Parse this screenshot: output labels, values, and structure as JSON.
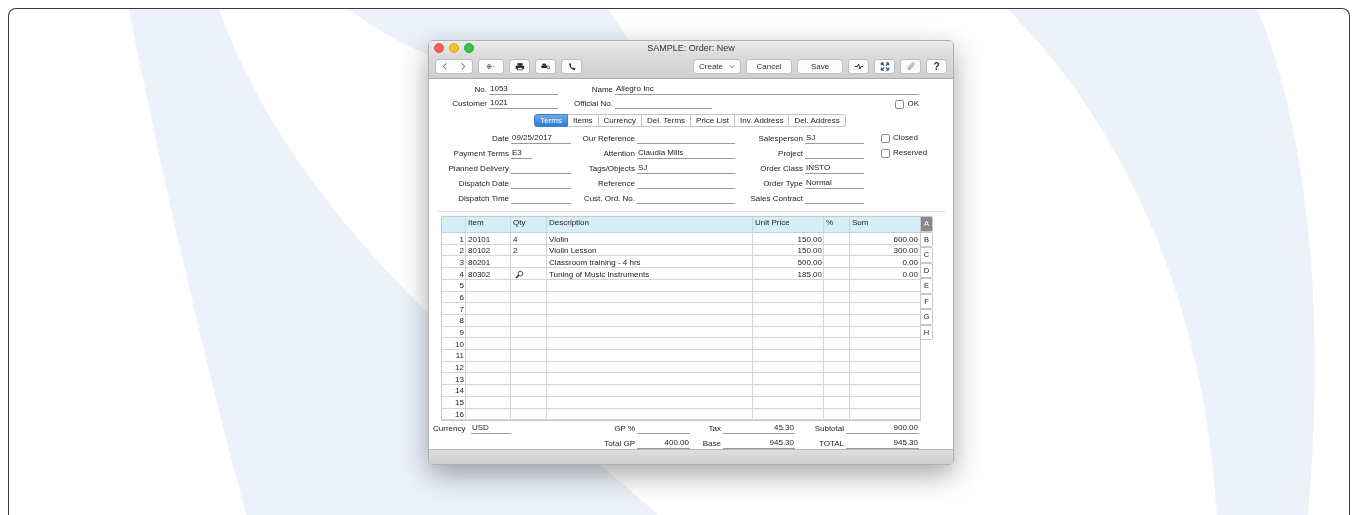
{
  "window": {
    "title": "SAMPLE: Order: New"
  },
  "toolbar": {
    "buttons": [
      {
        "label": "Create",
        "kind": "dropdown"
      },
      {
        "label": "Cancel",
        "kind": "plain"
      },
      {
        "label": "Save",
        "kind": "plain"
      }
    ],
    "help": "?"
  },
  "header": {
    "no": {
      "label": "No.",
      "value": "1053"
    },
    "name": {
      "label": "Name",
      "value": "Allegro Inc"
    },
    "customer": {
      "label": "Customer",
      "value": "1021"
    },
    "official_no": {
      "label": "Official No."
    },
    "ok": {
      "label": "OK",
      "checked": false
    }
  },
  "tabs": [
    {
      "label": "Terms",
      "selected": true
    },
    {
      "label": "Items",
      "selected": false
    },
    {
      "label": "Currency",
      "selected": false
    },
    {
      "label": "Del. Terms",
      "selected": false
    },
    {
      "label": "Price List",
      "selected": false
    },
    {
      "label": "Inv. Address",
      "selected": false
    },
    {
      "label": "Del. Address",
      "selected": false
    }
  ],
  "terms": {
    "column_1": [
      {
        "label": "Date",
        "value": "09/25/2017"
      },
      {
        "label": "Payment Terms",
        "value": "E3",
        "short": true
      },
      {
        "label": "Planned Delivery"
      },
      {
        "label": "Dispatch Date"
      },
      {
        "label": "Dispatch Time"
      }
    ],
    "column_2": [
      {
        "label": "Our Reference"
      },
      {
        "label": "Attention",
        "value": "Claudia Mills"
      },
      {
        "label": "Tags/Objects",
        "value": "SJ"
      },
      {
        "label": "Reference"
      },
      {
        "label": "Cust. Ord. No."
      }
    ],
    "column_3": [
      {
        "label": "Salesperson",
        "value": "SJ"
      },
      {
        "label": "Project"
      },
      {
        "label": "Order Class",
        "value": "INSTO"
      },
      {
        "label": "Order Type",
        "value": "Normal"
      },
      {
        "label": "Sales Contract"
      }
    ],
    "checkboxes": [
      {
        "label": "Closed",
        "checked": false
      },
      {
        "label": "Reserved",
        "checked": false
      }
    ]
  },
  "table": {
    "columns": [
      "Item",
      "Qty",
      "Description",
      "Unit Price",
      "%",
      "Sum"
    ],
    "rows": [
      {
        "no": "1",
        "item": "20101",
        "qty": "4",
        "description": "Violin",
        "unit_price": "150.00",
        "sum": "600.00",
        "lookup": false
      },
      {
        "no": "2",
        "item": "80102",
        "qty": "2",
        "description": "Violin Lesson",
        "unit_price": "150.00",
        "sum": "300.00",
        "lookup": false
      },
      {
        "no": "3",
        "item": "80201",
        "description": "Classroom training - 4 hrs",
        "unit_price": "500.00",
        "sum": "0.00",
        "lookup": false
      },
      {
        "no": "4",
        "item": "80302",
        "description": "Tuning of Music Instruments",
        "unit_price": "185.00",
        "sum": "0.00",
        "lookup": true
      },
      {
        "no": "5",
        "lookup": false
      },
      {
        "no": "6",
        "lookup": false
      },
      {
        "no": "7",
        "lookup": false
      },
      {
        "no": "8",
        "lookup": false
      },
      {
        "no": "9",
        "lookup": false
      },
      {
        "no": "10",
        "lookup": false
      },
      {
        "no": "11",
        "lookup": false
      },
      {
        "no": "12",
        "lookup": false
      },
      {
        "no": "13",
        "lookup": false
      },
      {
        "no": "14",
        "lookup": false
      },
      {
        "no": "15",
        "lookup": false
      },
      {
        "no": "16",
        "lookup": false
      }
    ],
    "side_tabs": [
      {
        "label": "A",
        "selected": true
      },
      {
        "label": "B",
        "selected": false
      },
      {
        "label": "C",
        "selected": false
      },
      {
        "label": "D",
        "selected": false
      },
      {
        "label": "E",
        "selected": false
      },
      {
        "label": "F",
        "selected": false
      },
      {
        "label": "G",
        "selected": false
      },
      {
        "label": "H",
        "selected": false
      }
    ]
  },
  "footer": {
    "currency": {
      "label": "Currency",
      "value": "USD"
    },
    "gp_percent": {
      "label": "GP %"
    },
    "tax": {
      "label": "Tax",
      "value": "45.30"
    },
    "subtotal": {
      "label": "Subtotal",
      "value": "900.00"
    },
    "total_gp": {
      "label": "Total GP",
      "value": "400.00"
    },
    "base": {
      "label": "Base",
      "value": "945.30"
    },
    "total": {
      "label": "TOTAL",
      "value": "945.30"
    }
  }
}
